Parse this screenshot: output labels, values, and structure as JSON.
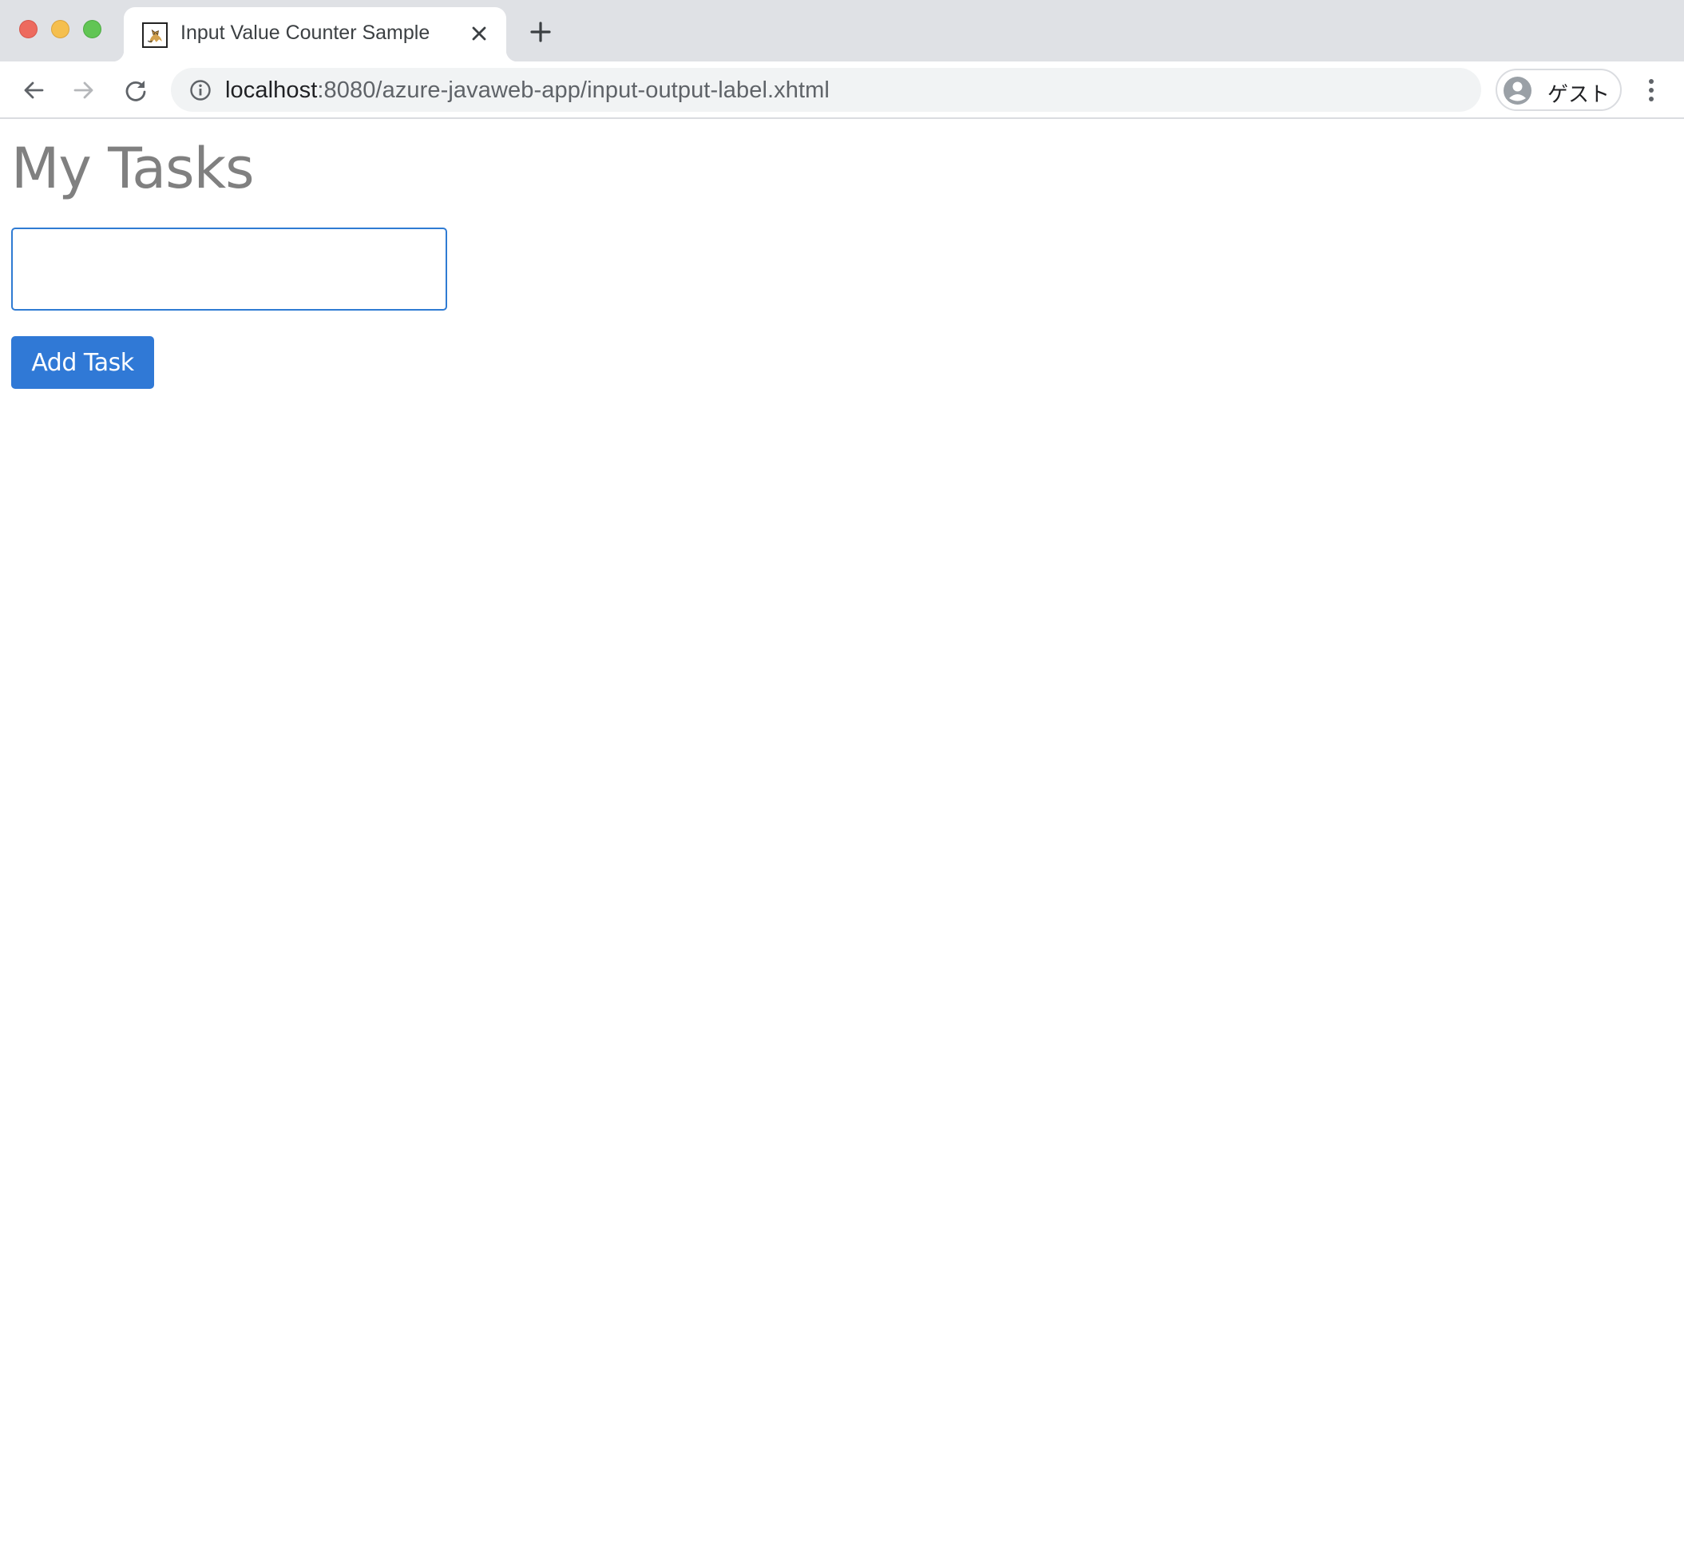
{
  "browser": {
    "window_controls": [
      "close",
      "minimize",
      "maximize"
    ],
    "tabs": [
      {
        "title": "Input Value Counter Sample",
        "favicon": "tomcat-icon",
        "active": true
      }
    ],
    "new_tab_icon": "plus-icon",
    "close_tab_icon": "close-icon",
    "nav": {
      "back_icon": "arrow-left-icon",
      "forward_icon": "arrow-right-icon",
      "reload_icon": "reload-icon"
    },
    "address_bar": {
      "info_icon": "info-icon",
      "url_host": "localhost",
      "url_rest": ":8080/azure-javaweb-app/input-output-label.xhtml"
    },
    "profile": {
      "label": "ゲスト",
      "icon": "avatar-icon"
    },
    "menu_icon": "kebab-menu-icon"
  },
  "page": {
    "title": "My Tasks",
    "task_input": {
      "value": "",
      "placeholder": ""
    },
    "add_button_label": "Add Task"
  },
  "colors": {
    "accent": "#3079d6",
    "input_border": "#2f7bd3",
    "title_text": "#808080",
    "tabstrip_bg": "#dfe1e5",
    "omnibox_bg": "#f1f3f4"
  }
}
